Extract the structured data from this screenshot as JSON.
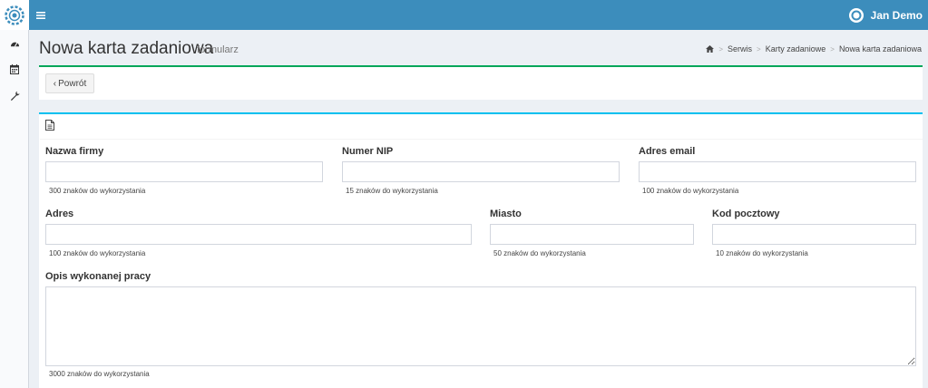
{
  "header": {
    "user_name": "Jan Demo"
  },
  "page": {
    "title": "Nowa karta zadaniowa",
    "subtitle": "formularz"
  },
  "breadcrumb": {
    "items": [
      "Serwis",
      "Karty zadaniowe",
      "Nowa karta zadaniowa"
    ]
  },
  "toolbar": {
    "back_label": "Powrót"
  },
  "form": {
    "company": {
      "label": "Nazwa firmy",
      "value": "",
      "help": "300 znaków do wykorzystania"
    },
    "nip": {
      "label": "Numer NIP",
      "value": "",
      "help": "15 znaków do wykorzystania"
    },
    "email": {
      "label": "Adres email",
      "value": "",
      "help": "100 znaków do wykorzystania"
    },
    "address": {
      "label": "Adres",
      "value": "",
      "help": "100 znaków do wykorzystania"
    },
    "city": {
      "label": "Miasto",
      "value": "",
      "help": "50 znaków do wykorzystania"
    },
    "postal": {
      "label": "Kod pocztowy",
      "value": "",
      "help": "10 znaków do wykorzystania"
    },
    "description": {
      "label": "Opis wykonanej pracy",
      "value": "",
      "help": "3000 znaków do wykorzystania"
    }
  },
  "colors": {
    "header": "#3c8dbc",
    "box_success": "#00a65a",
    "box_info": "#00c0ef"
  },
  "icons": {
    "logo": "gear-logo-icon",
    "sidebar": [
      "dashboard-icon",
      "calendar-icon",
      "wrench-icon"
    ],
    "menu": "hamburger-icon",
    "user": "user-avatar-icon",
    "home": "home-icon",
    "form": "document-icon"
  }
}
